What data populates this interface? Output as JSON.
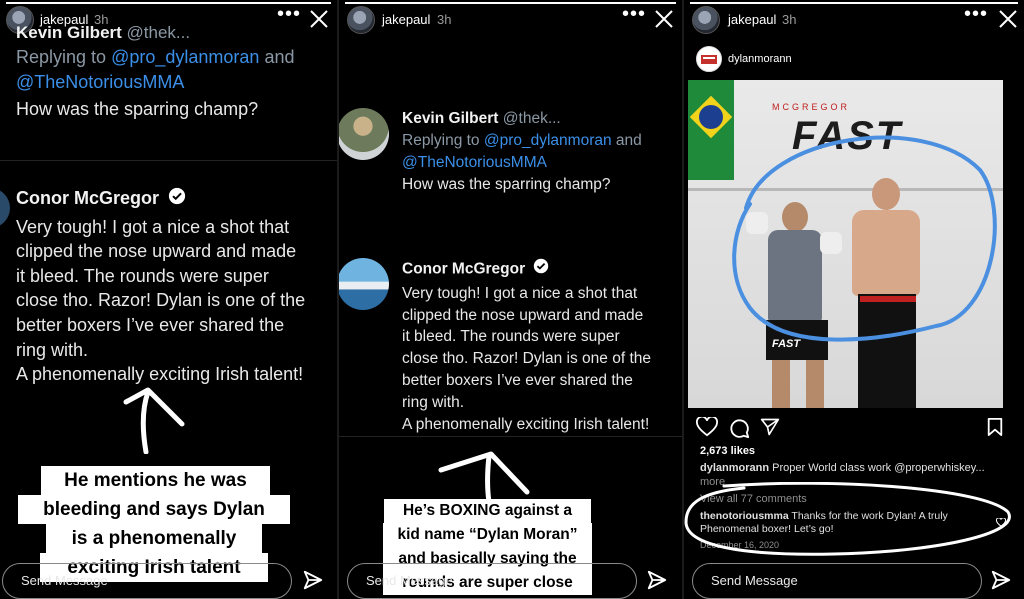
{
  "story": {
    "username": "jakepaul",
    "time": "3h",
    "send_placeholder": "Send Message"
  },
  "tweet_reply": {
    "name": "Kevin Gilbert",
    "handle": "@thek...",
    "replying_prefix": "Replying to",
    "replying_to_1": "@pro_dylanmoran",
    "replying_and": "and",
    "replying_to_2": "@TheNotoriousMMA",
    "text": "How was the sparring champ?"
  },
  "tweet_main": {
    "name": "Conor McGregor",
    "lines": [
      "Very tough! I got a nice a shot that",
      "clipped the nose upward and made",
      "it bleed. The rounds were super",
      "close tho. Razor! Dylan is one of the",
      "better boxers I’ve ever shared the",
      "ring with.",
      "A phenomenally exciting Irish talent!"
    ],
    "lines_narrow": [
      "Very tough! I got a nice a shot that",
      "clipped the nose upward and made",
      "it bleed. The rounds were super",
      "close tho. Razor! Dylan is one of the",
      "better boxers I’ve ever shared the",
      "ring with.",
      "A phenomenally exciting Irish talent!"
    ]
  },
  "captions": {
    "panel1": [
      "He mentions he was",
      "bleeding and says Dylan",
      "is a phenomenally",
      "exciting Irish talent"
    ],
    "panel2": [
      "He’s BOXING against a",
      "kid name “Dylan Moran”",
      "and basically saying the",
      "rounds are super close"
    ]
  },
  "instagram": {
    "account": "dylanmorann",
    "photo_banner_small": "MCGREGOR",
    "photo_banner_big": "FAST",
    "shorts_text": "FAST",
    "likes": "2,673 likes",
    "caption_user": "dylanmorann",
    "caption_text": "Proper World class work @properwhiskey...",
    "more": "more",
    "view_comments": "View all 77 comments",
    "comment_user": "thenotoriousmma",
    "comment_text_1": "Thanks for the work Dylan! A truly",
    "comment_text_2": "Phenomenal boxer! Let’s go!",
    "comment_date": "December 16, 2020"
  },
  "colors": {
    "link_blue": "#3b8fe8",
    "circle_blue": "#4a8fe0",
    "verified_bg": "#ffffff"
  }
}
